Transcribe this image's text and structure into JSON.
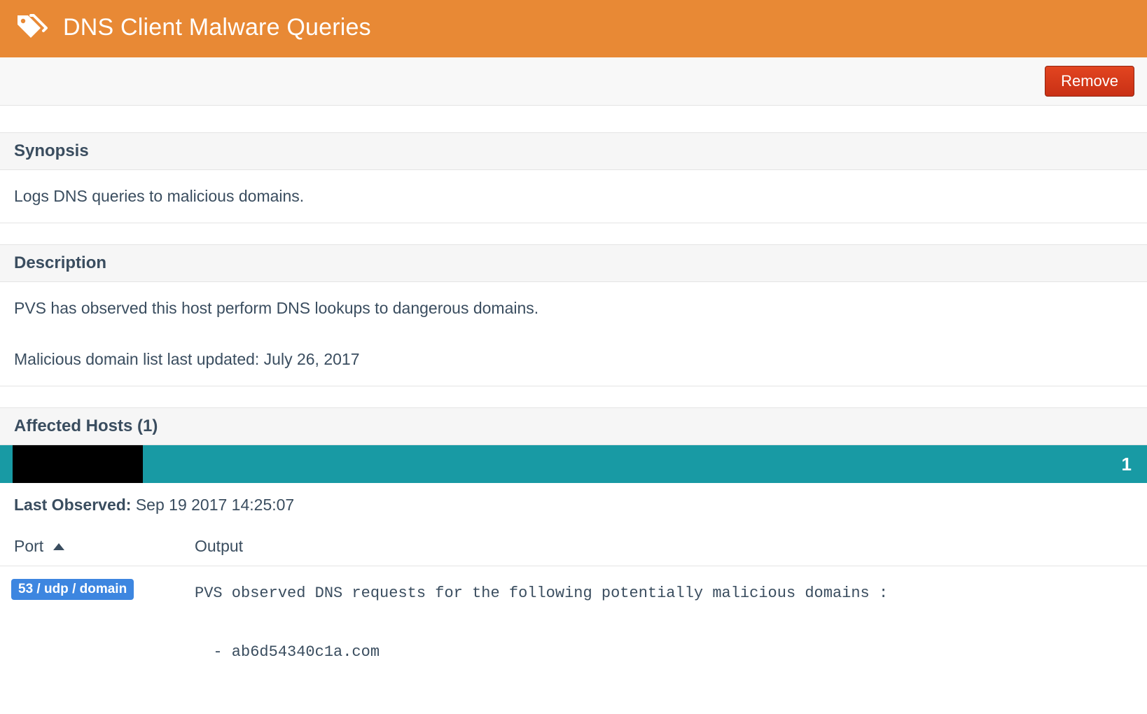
{
  "header": {
    "title": "DNS Client Malware Queries"
  },
  "actions": {
    "remove_label": "Remove"
  },
  "synopsis": {
    "heading": "Synopsis",
    "text": "Logs DNS queries to malicious domains."
  },
  "description": {
    "heading": "Description",
    "line1": "PVS has observed this host perform DNS lookups to dangerous domains.",
    "line2": "Malicious domain list last updated: July 26, 2017"
  },
  "affected_hosts": {
    "heading": "Affected Hosts (1)",
    "selected_host_name": "",
    "count": "1"
  },
  "last_observed": {
    "label": "Last Observed: ",
    "value": "Sep 19 2017 14:25:07"
  },
  "table": {
    "columns": {
      "port": "Port",
      "output": "Output"
    },
    "rows": [
      {
        "port": "53 / udp / domain",
        "output": "PVS observed DNS requests for the following potentially malicious domains :\n\n  - ab6d54340c1a.com"
      }
    ]
  }
}
